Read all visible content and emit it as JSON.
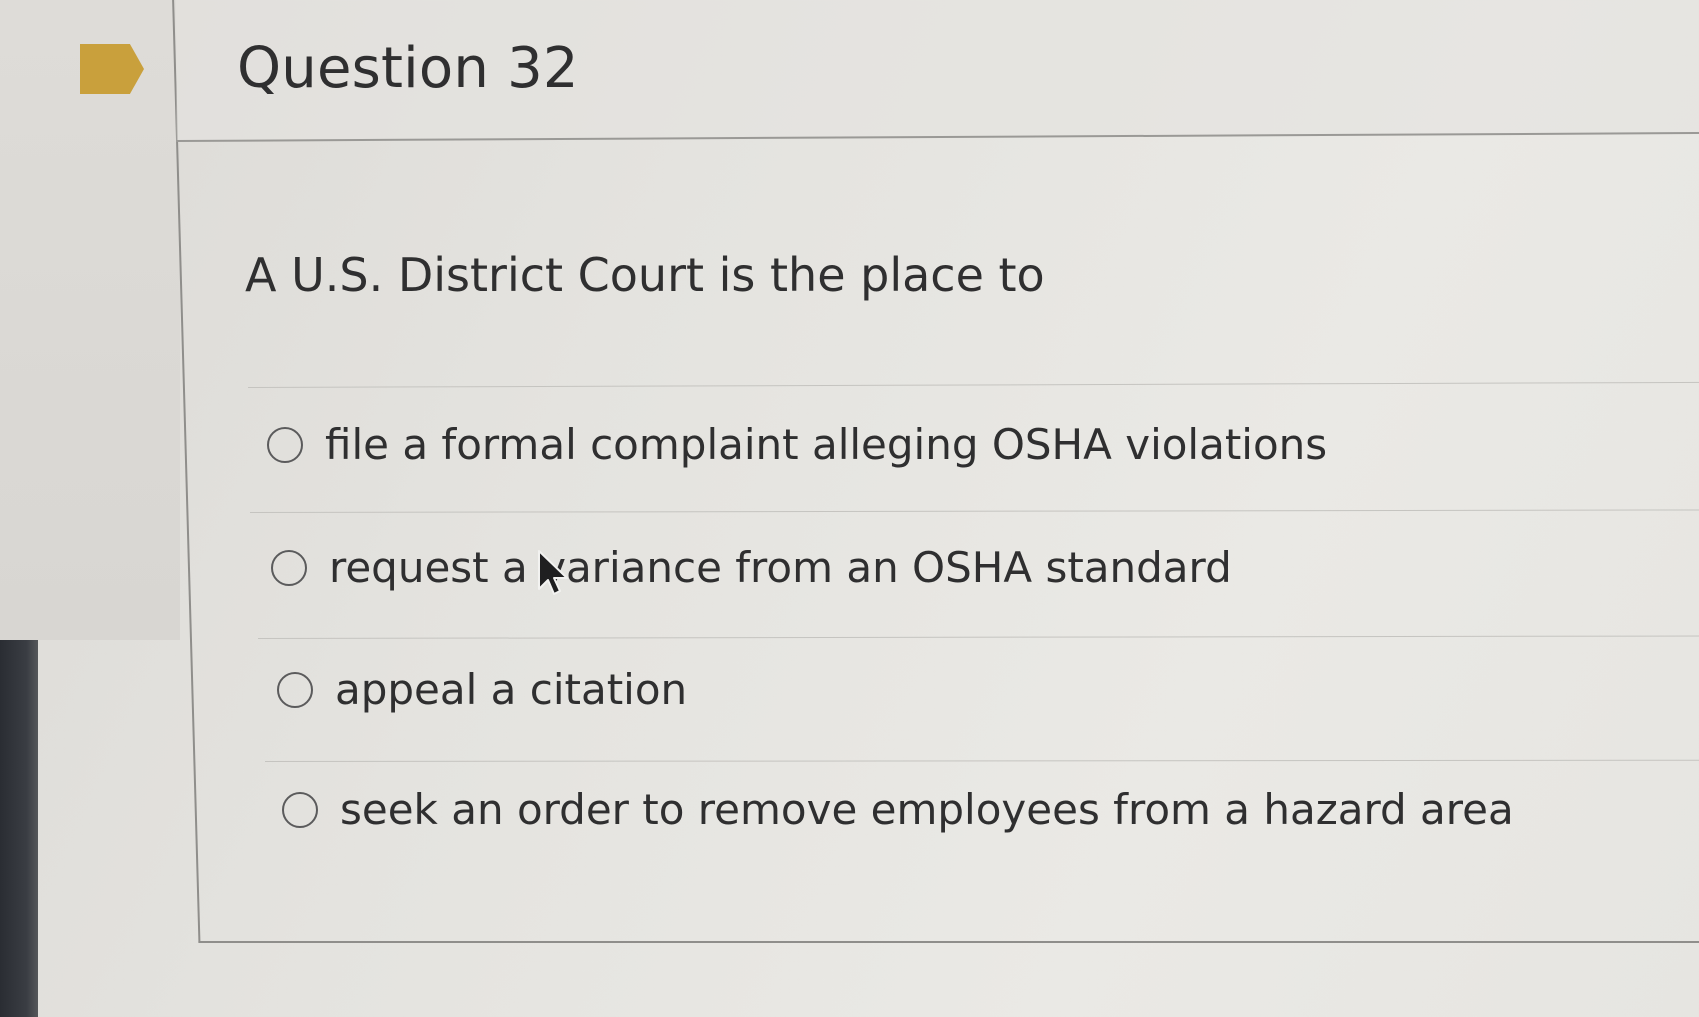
{
  "question": {
    "title": "Question 32",
    "prompt": "A U.S. District Court is the place to",
    "options": [
      {
        "label": "file a formal complaint alleging OSHA violations",
        "selected": false
      },
      {
        "label": "request a variance from an OSHA standard",
        "selected": false
      },
      {
        "label": "appeal a citation",
        "selected": false
      },
      {
        "label": "seek an order to remove employees from a hazard area",
        "selected": false
      }
    ]
  },
  "colors": {
    "flag": "#c9a03c",
    "text": "#2f2f30",
    "background": "#e6e5e1"
  },
  "icons": {
    "flag": "bookmark-flag-icon",
    "cursor": "mouse-pointer-icon",
    "radio": "radio-unchecked-icon"
  }
}
